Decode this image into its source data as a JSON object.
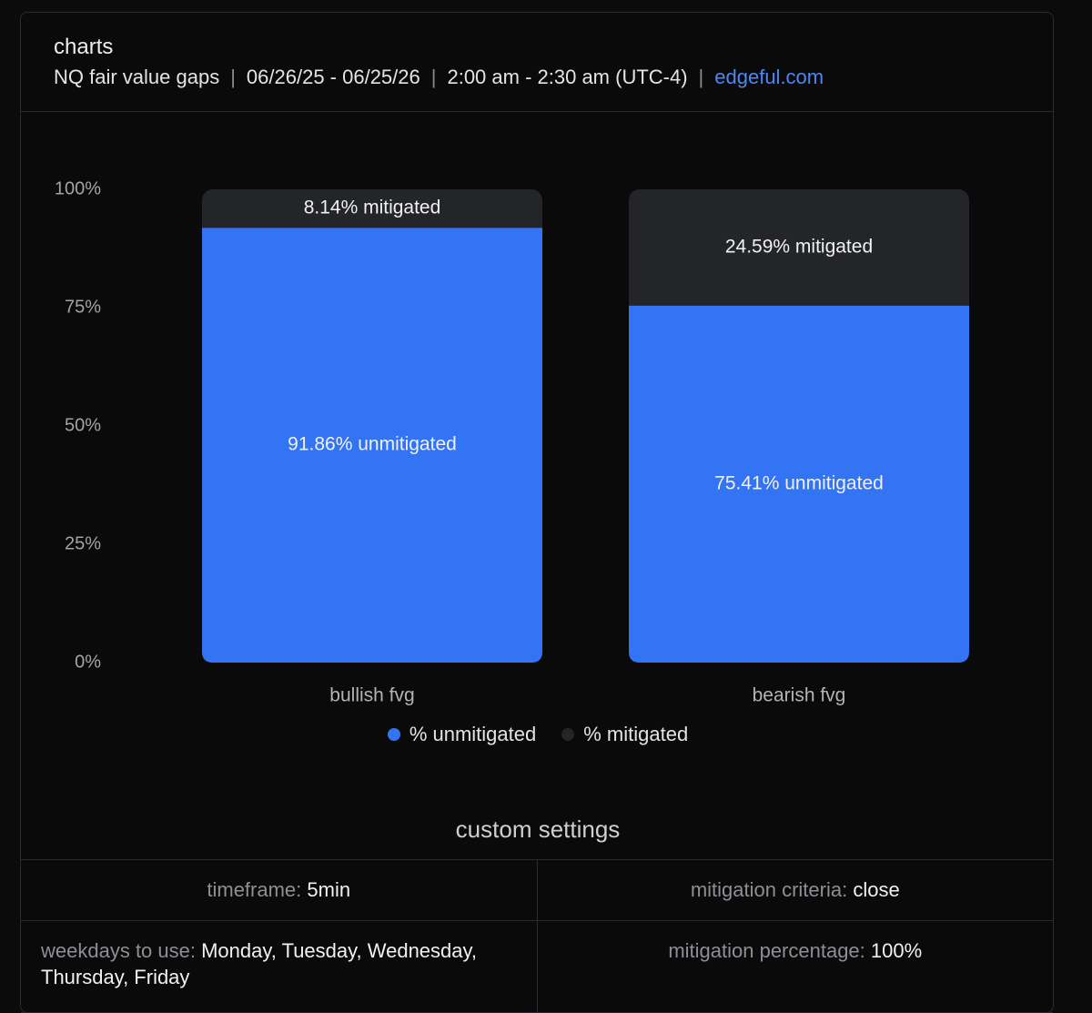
{
  "header": {
    "title": "charts",
    "instrument": "NQ fair value gaps",
    "date_range": "06/26/25 - 06/25/26",
    "time_range": "2:00 am - 2:30 am (UTC-4)",
    "site": "edgeful.com",
    "separator": "|"
  },
  "colors": {
    "unmitigated": "#3374f5",
    "mitigated": "#242528",
    "link": "#4e86f5"
  },
  "chart_data": {
    "type": "bar",
    "stacked": true,
    "categories": [
      "bullish fvg",
      "bearish fvg"
    ],
    "series": [
      {
        "name": "% unmitigated",
        "values": [
          91.86,
          75.41
        ],
        "labels": [
          "91.86% unmitigated",
          "75.41% unmitigated"
        ]
      },
      {
        "name": "% mitigated",
        "values": [
          8.14,
          24.59
        ],
        "labels": [
          "8.14% mitigated",
          "24.59% mitigated"
        ]
      }
    ],
    "yticks": [
      "0%",
      "25%",
      "50%",
      "75%",
      "100%"
    ],
    "ylim": [
      0,
      100
    ],
    "legend_position": "bottom-center"
  },
  "legend": {
    "unmitigated_label": "% unmitigated",
    "mitigated_label": "% mitigated"
  },
  "settings": {
    "title": "custom settings",
    "timeframe_label": "timeframe:",
    "timeframe_value": "5min",
    "criteria_label": "mitigation criteria:",
    "criteria_value": "close",
    "weekdays_label": "weekdays to use:",
    "weekdays_value": "Monday, Tuesday, Wednesday, Thursday, Friday",
    "percentage_label": "mitigation percentage:",
    "percentage_value": "100%"
  }
}
